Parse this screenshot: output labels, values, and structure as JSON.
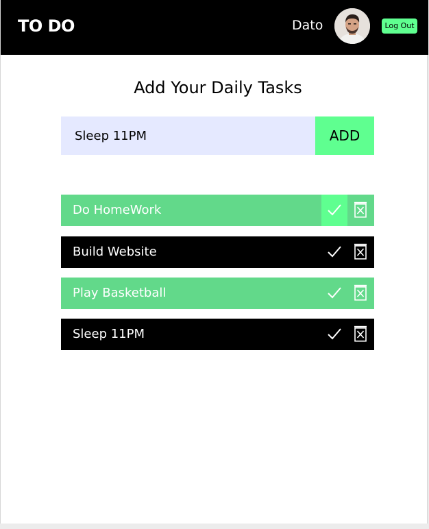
{
  "header": {
    "logo": "TO DO",
    "username": "Dato",
    "logout_label": "Log Out"
  },
  "main": {
    "title": "Add Your Daily Tasks",
    "input_value": "Sleep 11PM",
    "add_label": "ADD"
  },
  "tasks": [
    {
      "label": "Do HomeWork",
      "style": "green",
      "hover_check": true
    },
    {
      "label": "Build Website",
      "style": "black",
      "hover_check": false
    },
    {
      "label": "Play Basketball",
      "style": "green",
      "hover_check": false
    },
    {
      "label": "Sleep 11PM",
      "style": "black",
      "hover_check": false
    }
  ],
  "icons": {
    "check": "check-icon",
    "delete": "trash-icon",
    "avatar": "user-avatar"
  },
  "colors": {
    "accent": "#5fff90",
    "task_green": "#62d98a",
    "task_black": "#000000",
    "header": "#000000",
    "input_bg": "#e5e9ff"
  }
}
